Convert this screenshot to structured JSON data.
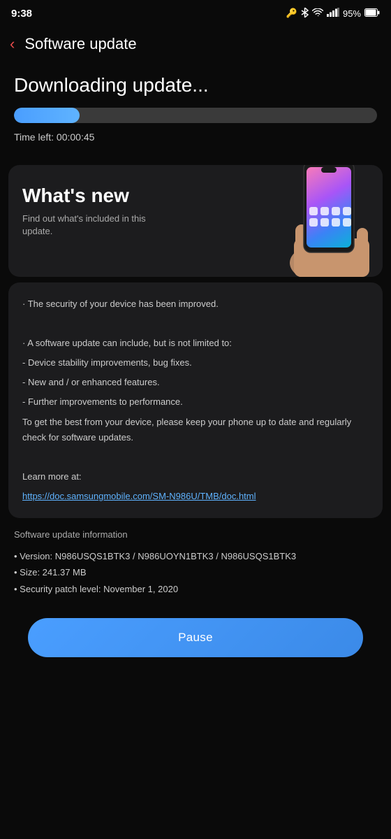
{
  "statusBar": {
    "time": "9:38",
    "battery": "95%",
    "icons": [
      "sim-card-icon",
      "bluetooth-icon",
      "wifi-icon",
      "signal-bars-icon",
      "battery-icon"
    ]
  },
  "nav": {
    "backLabel": "‹",
    "title": "Software update"
  },
  "download": {
    "heading": "Downloading update...",
    "progressPercent": 18,
    "timeLeft": "Time left: 00:00:45"
  },
  "whatsNew": {
    "title": "What's new",
    "description": "Find out what's included in this update."
  },
  "content": {
    "line1": "· The security of your device has been improved.",
    "line2": "· A software update can include, but is not limited to:",
    "line3": " - Device stability improvements, bug fixes.",
    "line4": " - New and / or enhanced features.",
    "line5": " - Further improvements to performance.",
    "line6": "To get the best from your device, please keep your phone up to date and regularly check for software updates.",
    "learnMoreLabel": "Learn more at:",
    "link": "https://doc.samsungmobile.com/SM-N986U/TMB/doc.html"
  },
  "updateInfo": {
    "sectionTitle": "Software update information",
    "version": "• Version: N986USQS1BTK3 / N986UOYN1BTK3 / N986USQS1BTK3",
    "size": "• Size: 241.37 MB",
    "securityPatch": "• Security patch level: November 1, 2020"
  },
  "actions": {
    "pauseLabel": "Pause"
  },
  "colors": {
    "accent": "#4a9eff",
    "background": "#0a0a0a",
    "card": "#1c1c1e",
    "backArrow": "#e84b4b"
  }
}
